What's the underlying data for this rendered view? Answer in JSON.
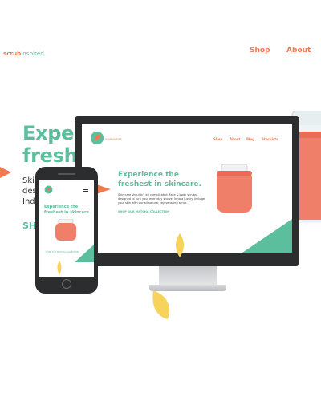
{
  "site": {
    "logo_part1": "scrub",
    "logo_part2": "inspired",
    "nav": [
      "Shop",
      "About"
    ],
    "hero_line1": "Experie",
    "hero_line2": "freshes",
    "hero_p1": "Skin",
    "hero_p2": "desig",
    "hero_p3": "Indu",
    "hero_cta": "SHO"
  },
  "monitor": {
    "nav": [
      "Shop",
      "About",
      "Blog",
      "Stockists"
    ],
    "title_line1": "Experience the",
    "title_line2": "freshest in skincare.",
    "description": "Skin care shouldn't be complicated. Face & body scrubs designed to turn your everyday shower in to a luxury. Indulge your skin with our all natural, rejuvenating scrub.",
    "cta": "SHOP OUR MATCHA COLLECTION"
  },
  "phone": {
    "title_line1": "Experience the",
    "title_line2": "freshest in skincare.",
    "cta": "SHOP OUR MATCHA COLLECTION"
  },
  "colors": {
    "accent_green": "#5bbf9d",
    "accent_orange": "#ef7a52",
    "accent_yellow": "#f7d35c",
    "device_dark": "#2b2d2f"
  }
}
